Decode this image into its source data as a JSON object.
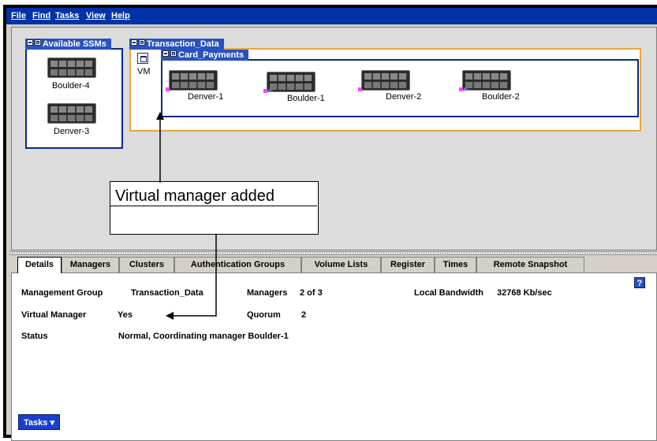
{
  "menu": {
    "file": "File",
    "find": "Find",
    "tasks": "Tasks",
    "view": "View",
    "help": "Help"
  },
  "map": {
    "available": {
      "title": "Available SSMs",
      "nodes": [
        "Boulder-4",
        "Denver-3"
      ]
    },
    "group": {
      "title": "Transaction_Data",
      "vm_label": "VM"
    },
    "cluster": {
      "title": "Card_Payments",
      "nodes": [
        "Denver-1",
        "Boulder-1",
        "Denver-2",
        "Boulder-2"
      ]
    },
    "callout": "Virtual manager added"
  },
  "tabs": [
    "Details",
    "Managers",
    "Clusters",
    "Authentication Groups",
    "Volume Lists",
    "Register",
    "Times",
    "Remote Snapshot"
  ],
  "active_tab": "Details",
  "details": {
    "mgmt_group_label": "Management Group",
    "mgmt_group_value": "Transaction_Data",
    "managers_label": "Managers",
    "managers_value": "2 of 3",
    "bandwidth_label": "Local Bandwidth",
    "bandwidth_value": "32768 Kb/sec",
    "vm_label": "Virtual Manager",
    "vm_value": "Yes",
    "quorum_label": "Quorum",
    "quorum_value": "2",
    "status_label": "Status",
    "status_value": "Normal, Coordinating manager Boulder-1",
    "help_label": "?"
  },
  "tasks_button": "Tasks",
  "icons": {
    "server": "server-icon",
    "collapse": "minus-icon",
    "window": "window-icon",
    "dropdown": "caret-down-icon"
  },
  "colors": {
    "menubar": "#0032a8",
    "group_title": "#2a52be",
    "group_border": "#0a2a84",
    "cluster_outline": "#e8a83a",
    "tasks_button": "#1a3fd0"
  }
}
